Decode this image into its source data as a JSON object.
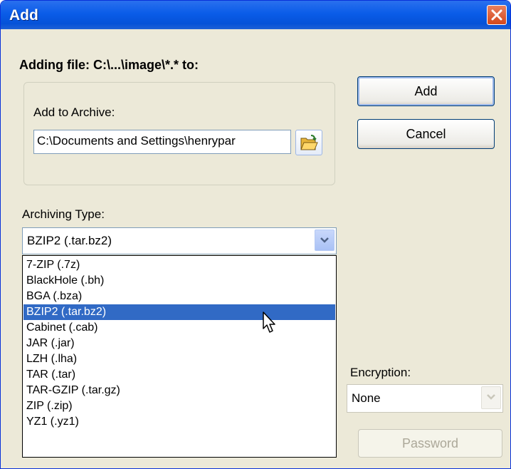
{
  "dialog": {
    "title": "Add"
  },
  "heading": "Adding file: C:\\...\\image\\*.* to:",
  "archive": {
    "label": "Add to Archive:",
    "path": "C:\\Documents and Settings\\henrypar"
  },
  "buttons": {
    "add": "Add",
    "cancel": "Cancel",
    "password": "Password"
  },
  "archiving_type": {
    "label": "Archiving Type:",
    "selected": "BZIP2 (.tar.bz2)",
    "options": [
      "7-ZIP (.7z)",
      "BlackHole (.bh)",
      "BGA (.bza)",
      "BZIP2 (.tar.bz2)",
      "Cabinet (.cab)",
      "JAR (.jar)",
      "LZH (.lha)",
      "TAR (.tar)",
      "TAR-GZIP (.tar.gz)",
      "ZIP (.zip)",
      "YZ1 (.yz1)"
    ],
    "highlighted_index": 3
  },
  "encryption": {
    "label": "Encryption:",
    "selected": "None"
  },
  "icons": {
    "close": "close-icon",
    "folder": "open-folder-icon",
    "dropdown_arrow": "chevron-down-icon",
    "cursor": "mouse-pointer-icon"
  },
  "colors": {
    "titlebar": "#0a5ce8",
    "selection": "#316ac5",
    "dialog_bg": "#ece9d8",
    "close": "#d4481b"
  }
}
